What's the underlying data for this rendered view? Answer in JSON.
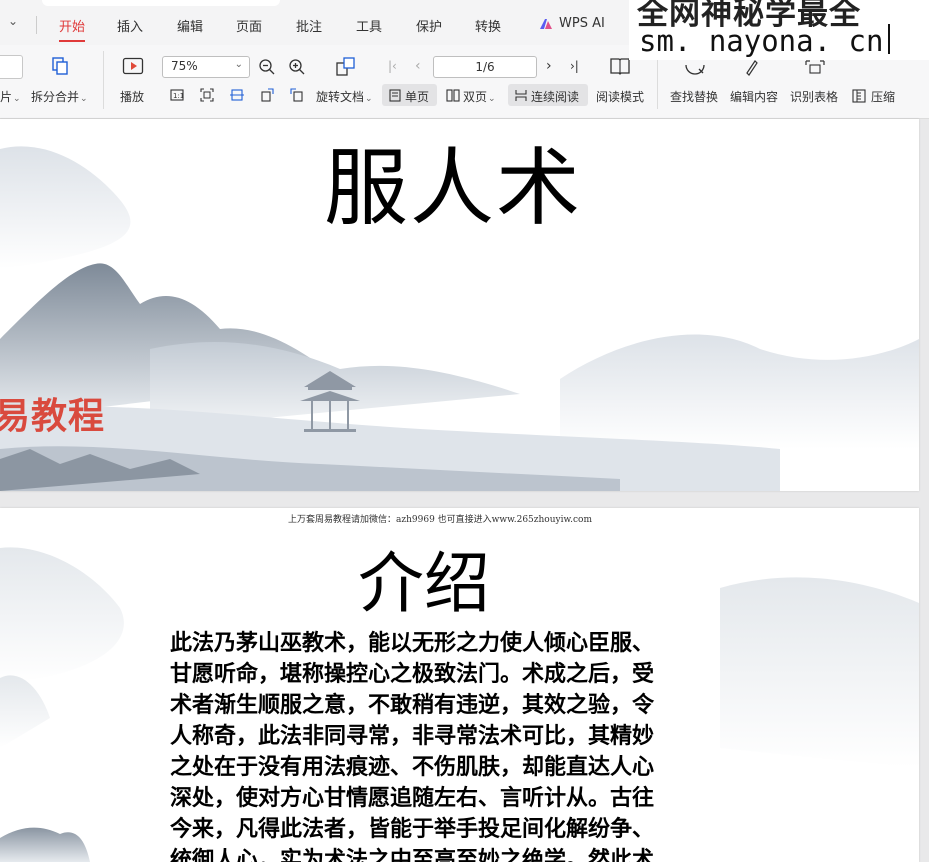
{
  "ribbon": {
    "tabs": [
      {
        "label": "开始",
        "active": true
      },
      {
        "label": "插入"
      },
      {
        "label": "编辑"
      },
      {
        "label": "页面"
      },
      {
        "label": "批注"
      },
      {
        "label": "工具"
      },
      {
        "label": "保护"
      },
      {
        "label": "转换"
      },
      {
        "label": "WPS AI"
      }
    ]
  },
  "watermark": {
    "line1": "全网神秘学最全",
    "line2": "sm. nayona. cn"
  },
  "toolbar": {
    "clipped_left": "片",
    "split_merge": "拆分合并",
    "play": "播放",
    "zoom_value": "75%",
    "rotate_doc": "旋转文档",
    "page_indicator": "1/6",
    "single_page": "单页",
    "double_page": "双页",
    "continuous": "连续阅读",
    "reading_mode": "阅读模式",
    "find_replace": "查找替换",
    "edit_content": "编辑内容",
    "recognize_table": "识别表格",
    "compress": "压缩"
  },
  "document": {
    "page1": {
      "title": "服人术",
      "brand_text": "易教程"
    },
    "page2": {
      "header": "上万套周易教程请加微信：azh9969   也可直接进入www.265zhouyiw.com",
      "title": "介绍",
      "body_lines": [
        "此法乃茅山巫教术，能以无形之力使人倾心臣服、",
        "甘愿听命，堪称操控心之极致法门。术成之后，受",
        "术者渐生顺服之意，不敢稍有违逆，其效之验，令",
        "人称奇，此法非同寻常，非寻常法术可比，其精妙",
        "之处在于没有用法痕迹、不伤肌肤，却能直达人心",
        "深处，使对方心甘情愿追随左右、言听计从。古往",
        "今来，凡得此法者，皆能于举手投足间化解纷争、",
        "统御人心，实为术法之中至高至妙之绝学。然此术"
      ]
    }
  },
  "colors": {
    "accent": "#e03a3a",
    "brand_red": "#d94a3e"
  }
}
